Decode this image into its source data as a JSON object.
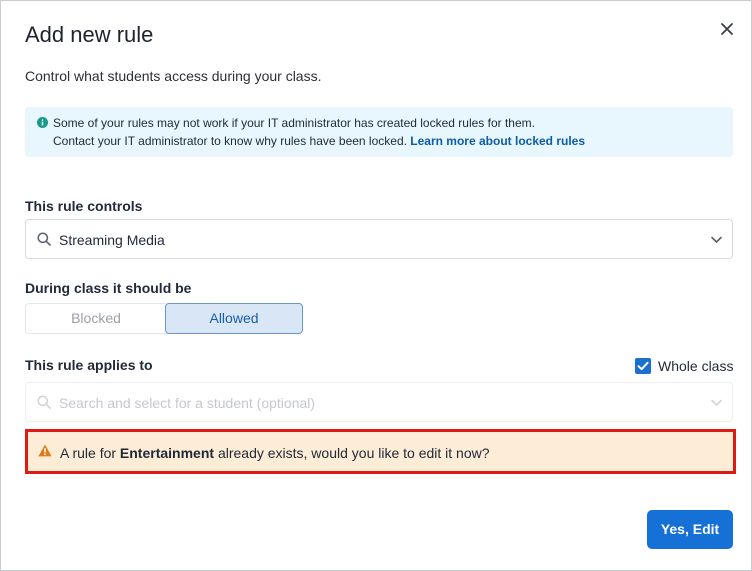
{
  "dialog": {
    "title": "Add new rule",
    "subtitle": "Control what students access during your class."
  },
  "info": {
    "line1": "Some of your rules may not work if your IT administrator has created locked rules for them.",
    "line2_prefix": "Contact your IT administrator to know why rules have been locked.",
    "link": "Learn more about locked rules"
  },
  "rule_controls": {
    "label": "This rule controls",
    "value": "Streaming Media"
  },
  "during_class": {
    "label": "During class it should be",
    "options": [
      "Blocked",
      "Allowed"
    ],
    "selected": "Allowed"
  },
  "applies_to": {
    "label": "This rule applies to",
    "checkbox_label": "Whole class",
    "checked": true,
    "placeholder": "Search and select for a student (optional)"
  },
  "warning": {
    "prefix": "A rule for",
    "entity": "Entertainment",
    "suffix": "already exists, would you like to edit it now?"
  },
  "actions": {
    "primary": "Yes, Edit"
  },
  "colors": {
    "primary": "#1571d6",
    "warning_border": "#dd1b14",
    "warning_bg": "#fdecd6",
    "info_bg": "#e8f6fd",
    "info_icon": "#1a9a8a",
    "warning_icon": "#e07b1a"
  }
}
